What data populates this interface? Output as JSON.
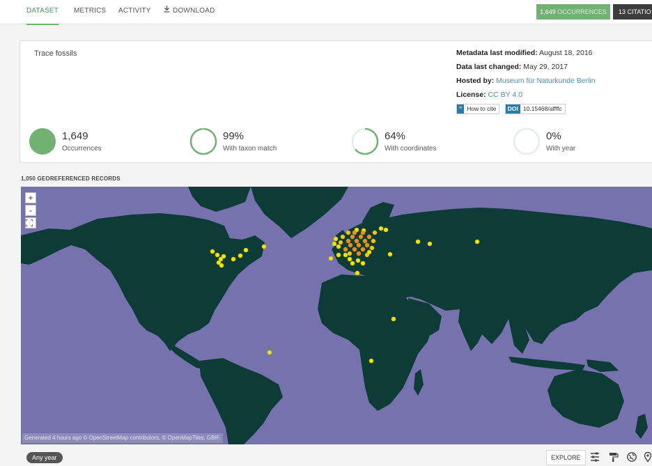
{
  "nav": {
    "tabs": [
      {
        "label": "DATASET",
        "active": true
      },
      {
        "label": "METRICS",
        "active": false
      },
      {
        "label": "ACTIVITY",
        "active": false
      },
      {
        "label": "DOWNLOAD",
        "active": false,
        "icon": "download-icon"
      }
    ],
    "occurrences_count": "1,649",
    "occurrences_word": "OCCURRENCES",
    "citations_label": "13 CITATIO"
  },
  "dataset": {
    "title": "Trace fossils",
    "metadata_modified_label": "Metadata last modified:",
    "metadata_modified_value": "August 18, 2016",
    "data_changed_label": "Data last changed:",
    "data_changed_value": "May 29, 2017",
    "hosted_by_label": "Hosted by:",
    "hosted_by_value": "Museum für Naturkunde Berlin",
    "license_label": "License:",
    "license_value": "CC BY 4.0",
    "cite_badge": "”",
    "cite_label": "How to cite",
    "doi_badge": "DOI",
    "doi_value": "10.15468/affffc"
  },
  "stats": [
    {
      "value": "1,649",
      "label": "Occurrences",
      "fraction": 1.0
    },
    {
      "value": "99%",
      "label": "With taxon match",
      "fraction": 0.99
    },
    {
      "value": "64%",
      "label": "With coordinates",
      "fraction": 0.64
    },
    {
      "value": "0%",
      "label": "With year",
      "fraction": 0.0
    }
  ],
  "map": {
    "section_label": "1,050 GEOREFERENCED RECORDS",
    "zoom_in": "+",
    "zoom_out": "-",
    "fullscreen_icon": "fullscreen-icon",
    "attribution": "Generated 4 hours ago © OpenStreetMap contributors, © OpenMapTiles, GBIF.",
    "colors": {
      "ocean": "#7572ad",
      "land": "#0d3b36",
      "point": "#f2e600",
      "dense": "#f08a1c"
    }
  },
  "toolbar": {
    "year_filter": "Any year",
    "explore_label": "EXPLORE",
    "icons": [
      "sliders-icon",
      "paint-roller-icon",
      "globe-icon",
      "location-icon"
    ]
  },
  "colors": {
    "accent": "#71b171",
    "dark_pill": "#3d3d3d",
    "link": "#4a8bc9",
    "doi_blue": "#2a7ab0"
  }
}
